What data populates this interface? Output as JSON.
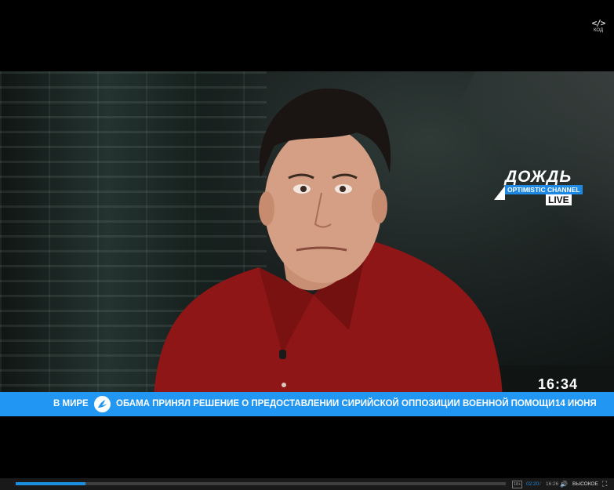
{
  "embed": {
    "glyph": "</>",
    "label": "КОД"
  },
  "channel": {
    "wordmark": "ДОЖДЬ",
    "tagline": "OPTIMISTIC CHANNEL",
    "live": "LIVE",
    "accent_color": "#2196f3"
  },
  "clock": "16:34",
  "ticker": {
    "category": "В МИРЕ",
    "icon": "bird-icon",
    "headline": "ОБАМА ПРИНЯЛ РЕШЕНИЕ О ПРЕДОСТАВЛЕНИИ СИРИЙСКОЙ ОППОЗИЦИИ ВОЕННОЙ ПОМОЩИ",
    "date": "14 ИЮНЯ"
  },
  "player": {
    "progress_percent": 14.3,
    "age_rating": "18+",
    "current_time": "02:20",
    "separator": "/",
    "duration": "16:26",
    "volume_icon": "speaker-icon",
    "quality": "ВЫСОКОЕ",
    "fullscreen_icon": "fullscreen-icon"
  }
}
